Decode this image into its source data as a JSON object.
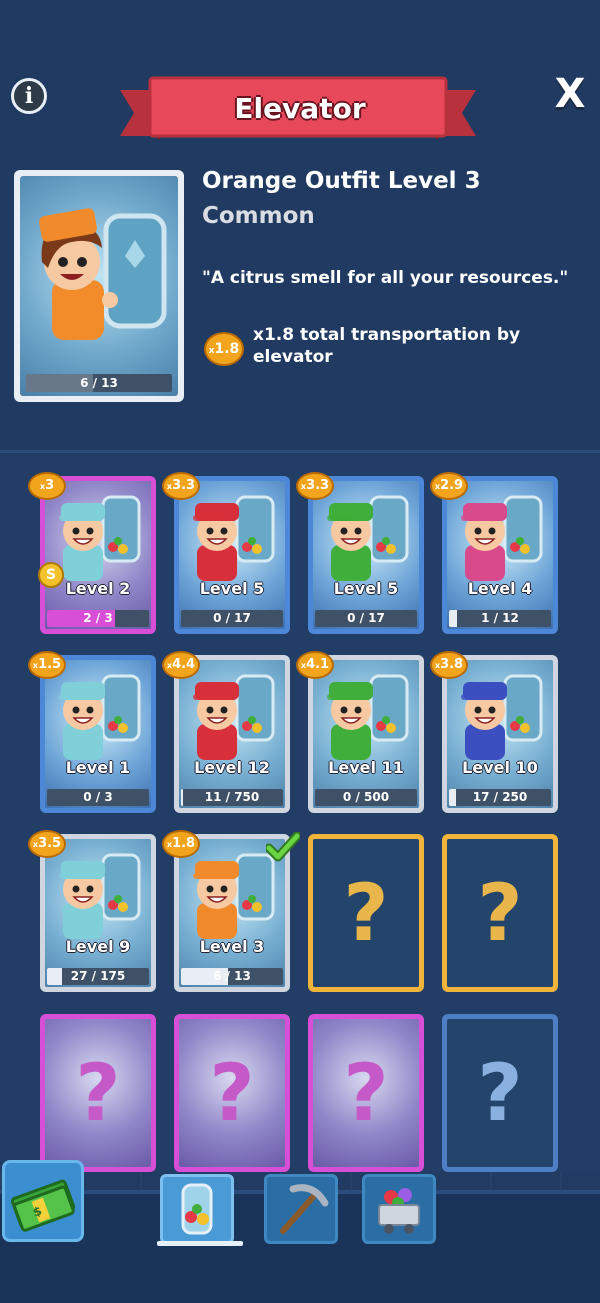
{
  "header": {
    "title": "Elevator",
    "info_icon": "info-icon",
    "close_icon": "close-icon",
    "close_label": "X"
  },
  "item": {
    "name": "Orange Outfit Level 3",
    "rarity": "Common",
    "quote": "\"A citrus smell for all your resources.\"",
    "bonus_multiplier": "1.8",
    "bonus_text": "x1.8 total transportation by elevator",
    "progress_text": "6 / 13",
    "progress_fraction": 0.46
  },
  "cards": [
    {
      "multiplier": "3",
      "level": "Level 2",
      "progress": "2 / 3",
      "fraction": 0.67,
      "frame": "purple",
      "hat": "#7fd0d8"
    },
    {
      "multiplier": "3.3",
      "level": "Level 5",
      "progress": "0 / 17",
      "fraction": 0,
      "frame": "blue",
      "hat": "#d8303a"
    },
    {
      "multiplier": "3.3",
      "level": "Level 5",
      "progress": "0 / 17",
      "fraction": 0,
      "frame": "blue",
      "hat": "#3fae3a"
    },
    {
      "multiplier": "2.9",
      "level": "Level 4",
      "progress": "1 / 12",
      "fraction": 0.08,
      "frame": "blue",
      "hat": "#d84a8c"
    },
    {
      "multiplier": "1.5",
      "level": "Level 1",
      "progress": "0 / 3",
      "fraction": 0,
      "frame": "blue",
      "hat": "#7fd0d8"
    },
    {
      "multiplier": "4.4",
      "level": "Level 12",
      "progress": "11 / 750",
      "fraction": 0.015,
      "frame": "silver",
      "hat": "#d8303a"
    },
    {
      "multiplier": "4.1",
      "level": "Level 11",
      "progress": "0 / 500",
      "fraction": 0,
      "frame": "silver",
      "hat": "#3fae3a"
    },
    {
      "multiplier": "3.8",
      "level": "Level 10",
      "progress": "17 / 250",
      "fraction": 0.07,
      "frame": "silver",
      "hat": "#3c4fc0"
    },
    {
      "multiplier": "3.5",
      "level": "Level 9",
      "progress": "27 / 175",
      "fraction": 0.15,
      "frame": "silver",
      "hat": "#7fd0d8"
    },
    {
      "multiplier": "1.8",
      "level": "Level 3",
      "progress": "6 / 13",
      "fraction": 0.46,
      "frame": "silver",
      "hat": "#f08a2a",
      "equipped": true
    }
  ],
  "locked_cards": [
    {
      "frame": "gold",
      "label": "?"
    },
    {
      "frame": "gold",
      "label": "?"
    },
    {
      "frame": "purple",
      "label": "?"
    },
    {
      "frame": "purple",
      "label": "?"
    },
    {
      "frame": "purple",
      "label": "?"
    },
    {
      "frame": "dim-blue",
      "label": "?"
    }
  ],
  "coin_label": "S",
  "multiplier_prefix": "x",
  "bottom_nav": {
    "shop_icon": "cash-icon",
    "tabs": [
      {
        "icon": "gem-elevator-icon",
        "active": true
      },
      {
        "icon": "pickaxe-icon",
        "active": false
      },
      {
        "icon": "mine-cart-icon",
        "active": false
      }
    ]
  },
  "colors": {
    "background": "#203a61",
    "ribbon": "#e8495a",
    "badge": "#f2a51c",
    "check": "#5ccc3c"
  }
}
